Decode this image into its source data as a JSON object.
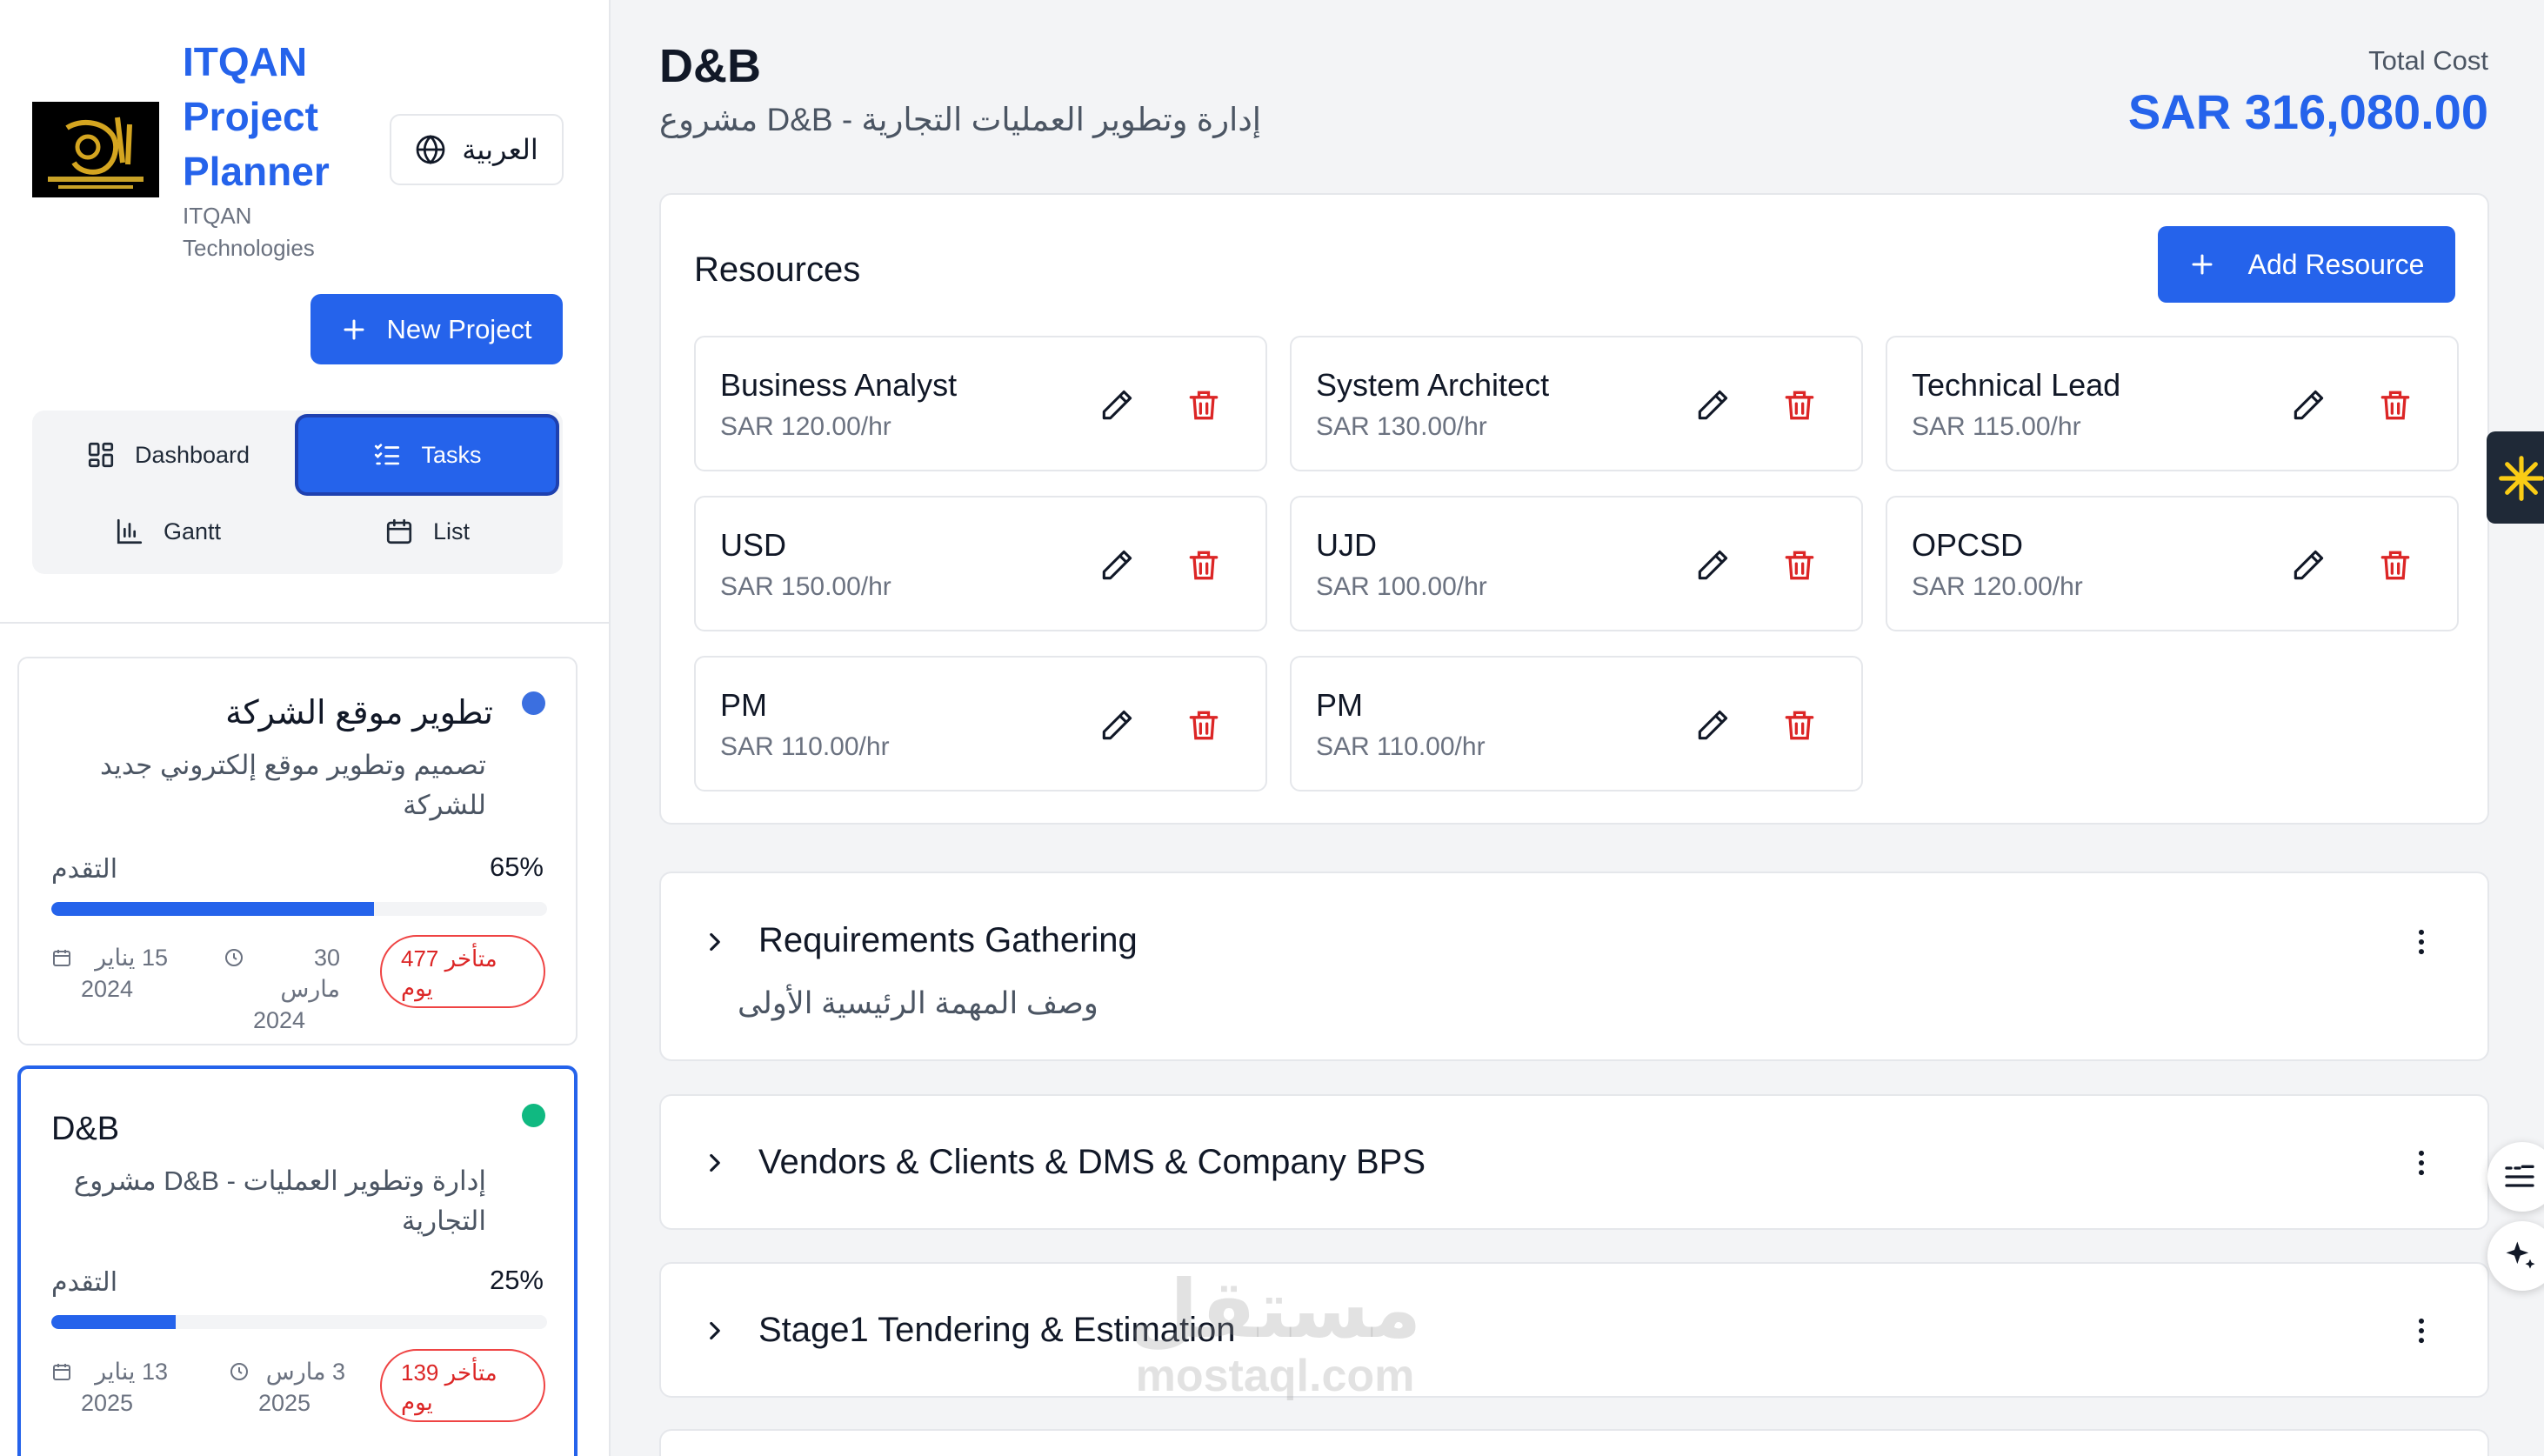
{
  "brand": {
    "title_line1": "ITQAN",
    "title_line2": "Project",
    "title_line3": "Planner",
    "sub_line1": "ITQAN",
    "sub_line2": "Technologies",
    "logo_icon": "itqan-logo"
  },
  "lang_button": {
    "label": "العربية",
    "icon": "globe-icon"
  },
  "new_project": {
    "label": "New Project",
    "icon": "plus-icon"
  },
  "view_nav": [
    {
      "label": "Dashboard",
      "icon": "dashboard-grid-icon",
      "active": false
    },
    {
      "label": "Tasks",
      "icon": "tasks-list-icon",
      "active": true
    },
    {
      "label": "Gantt",
      "icon": "bar-chart-icon",
      "active": false
    },
    {
      "label": "List",
      "icon": "calendar-icon",
      "active": false
    }
  ],
  "projects": [
    {
      "title": "تطوير موقع الشركة",
      "description_line1": "تصميم وتطوير موقع إلكتروني جديد",
      "description_line2": "للشركة",
      "dot_color": "#3b6fe0",
      "progress_label": "التقدم",
      "progress_text": "65%",
      "progress_fraction": 0.65,
      "start_day": "15 يناير",
      "start_year": "2024",
      "end_day": "30 مارس",
      "end_year": "2024",
      "overdue_line1": "477 متأخر",
      "overdue_line2": "يوم",
      "selected": false
    },
    {
      "title": "D&B",
      "description_line1": "إدارة وتطوير العمليات - D&B مشروع",
      "description_line2": "التجارية",
      "dot_color": "#10b981",
      "progress_label": "التقدم",
      "progress_text": "25%",
      "progress_fraction": 0.25,
      "start_day": "13 يناير",
      "start_year": "2025",
      "end_day": "3 مارس",
      "end_year": "2025",
      "overdue_line1": "139 متأخر",
      "overdue_line2": "يوم",
      "selected": true
    }
  ],
  "header": {
    "title": "D&B",
    "subtitle": "إدارة وتطوير العمليات التجارية - D&B مشروع",
    "total_label": "Total Cost",
    "total_value": "SAR 316,080.00"
  },
  "resources": {
    "title": "Resources",
    "add_label": "Add Resource",
    "items": [
      {
        "name": "Business Analyst",
        "rate": "SAR 120.00/hr"
      },
      {
        "name": "System Architect",
        "rate": "SAR 130.00/hr"
      },
      {
        "name": "Technical Lead",
        "rate": "SAR 115.00/hr"
      },
      {
        "name": "USD",
        "rate": "SAR 150.00/hr"
      },
      {
        "name": "UJD",
        "rate": "SAR 100.00/hr"
      },
      {
        "name": "OPCSD",
        "rate": "SAR 120.00/hr"
      },
      {
        "name": "PM",
        "rate": "SAR 110.00/hr"
      },
      {
        "name": "PM",
        "rate": "SAR 110.00/hr"
      }
    ]
  },
  "tasks": [
    {
      "title": "Requirements Gathering",
      "description": "وصف المهمة الرئيسية الأولى"
    },
    {
      "title": "Vendors & Clients & DMS & Company BPS"
    },
    {
      "title": "Stage1 Tendering & Estimation"
    }
  ],
  "watermark": {
    "line1": "مستقل",
    "line2": "mostaql.com"
  },
  "colors": {
    "accent": "#2563eb",
    "danger": "#dc2626",
    "border": "#e5e7eb",
    "background": "#f3f4f6"
  }
}
